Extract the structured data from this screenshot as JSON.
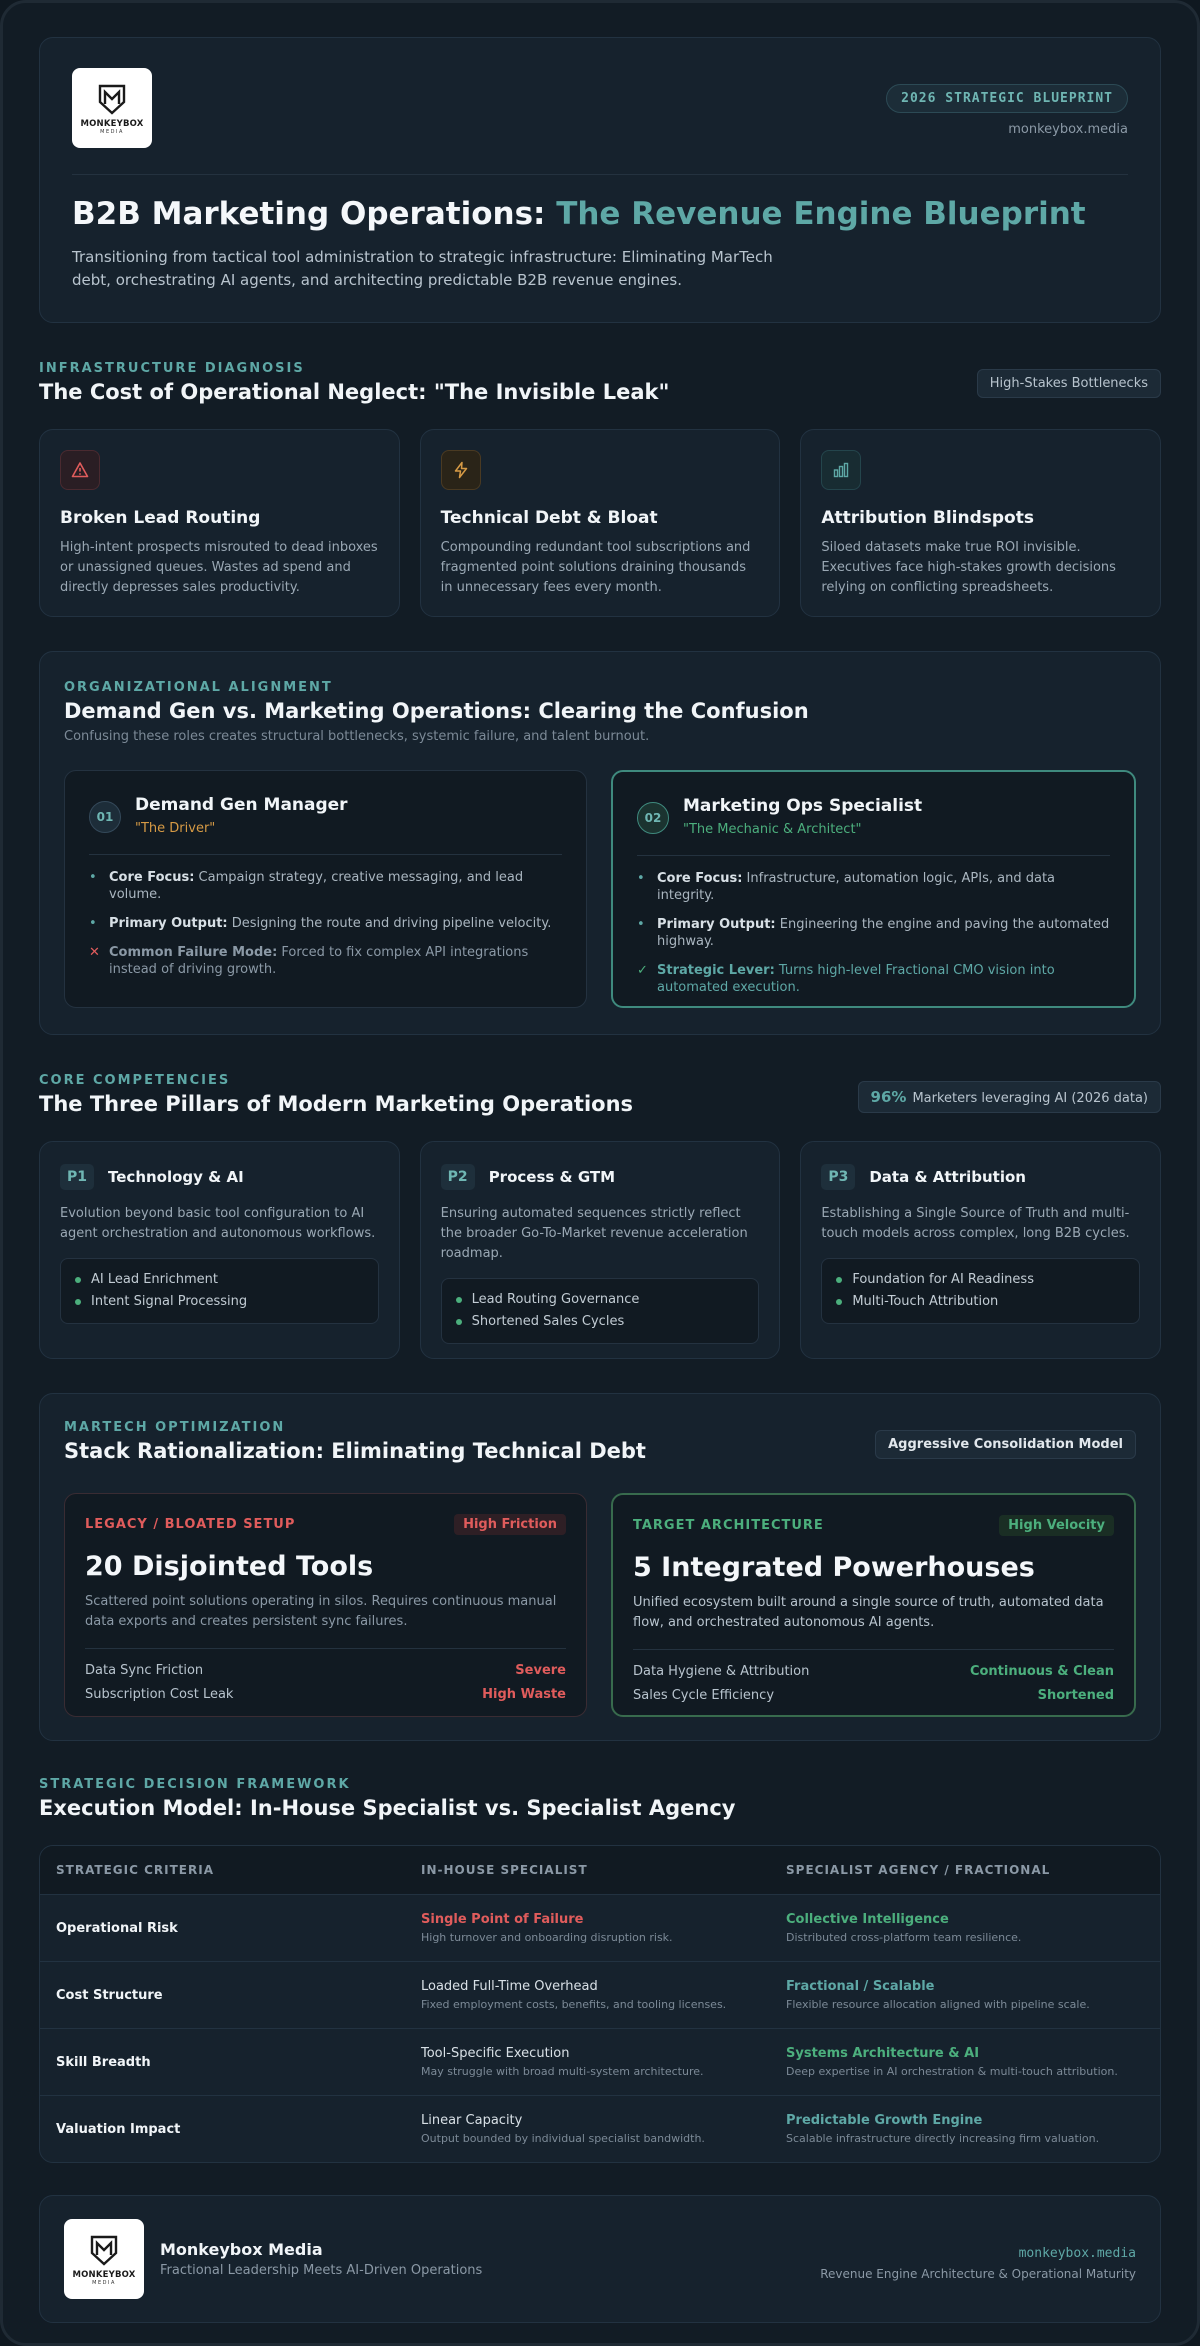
{
  "hero": {
    "logo": {
      "brand": "MONKEYBOX",
      "sub": "MEDIA"
    },
    "badge": "2026 STRATEGIC BLUEPRINT",
    "url": "monkeybox.media",
    "title_main": "B2B Marketing Operations: ",
    "title_accent": "The Revenue Engine Blueprint",
    "description": "Transitioning from tactical tool administration to strategic infrastructure: Eliminating MarTech debt, orchestrating AI agents, and architecting predictable B2B revenue engines."
  },
  "diagnosis": {
    "eyebrow": "INFRASTRUCTURE DIAGNOSIS",
    "title": "The Cost of Operational Neglect: \"The Invisible Leak\"",
    "tag": "High-Stakes Bottlenecks",
    "cards": [
      {
        "icon": "warning-icon",
        "color": "#e05c5c",
        "title": "Broken Lead Routing",
        "text": "High-intent prospects misrouted to dead inboxes or unassigned queues. Wastes ad spend and directly depresses sales productivity."
      },
      {
        "icon": "lightning-icon",
        "color": "#d69a45",
        "title": "Technical Debt & Bloat",
        "text": "Compounding redundant tool subscriptions and fragmented point solutions draining thousands in unnecessary fees every month."
      },
      {
        "icon": "bar-chart-icon",
        "color": "#5ea8a6",
        "title": "Attribution Blindspots",
        "text": "Siloed datasets make true ROI invisible. Executives face high-stakes growth decisions relying on conflicting spreadsheets."
      }
    ]
  },
  "alignment": {
    "eyebrow": "ORGANIZATIONAL ALIGNMENT",
    "title": "Demand Gen vs. Marketing Operations: Clearing the Confusion",
    "subtitle": "Confusing these roles creates structural bottlenecks, systemic failure, and talent burnout.",
    "roles": [
      {
        "num": "01",
        "title": "Demand Gen Manager",
        "nick": "\"The Driver\"",
        "nick_color": "#d69a45",
        "bullets": [
          {
            "mark": "•",
            "mark_color": "#5ea8a6",
            "label": "Core Focus:",
            "text": " Campaign strategy, creative messaging, and lead volume."
          },
          {
            "mark": "•",
            "mark_color": "#5ea8a6",
            "label": "Primary Output:",
            "text": " Designing the route and driving pipeline velocity."
          },
          {
            "mark": "✕",
            "mark_color": "#e05c5c",
            "label": "Common Failure Mode:",
            "text": " Forced to fix complex API integrations instead of driving growth."
          }
        ]
      },
      {
        "num": "02",
        "title": "Marketing Ops Specialist",
        "nick": "\"The Mechanic & Architect\"",
        "nick_color": "#4caf7d",
        "bullets": [
          {
            "mark": "•",
            "mark_color": "#5ea8a6",
            "label": "Core Focus:",
            "text": " Infrastructure, automation logic, APIs, and data integrity."
          },
          {
            "mark": "•",
            "mark_color": "#5ea8a6",
            "label": "Primary Output:",
            "text": " Engineering the engine and paving the automated highway."
          },
          {
            "mark": "✓",
            "mark_color": "#4caf7d",
            "label": "Strategic Lever:",
            "text": " Turns high-level Fractional CMO vision into automated execution."
          }
        ]
      }
    ]
  },
  "pillars": {
    "eyebrow": "CORE COMPETENCIES",
    "title": "The Three Pillars of Modern Marketing Operations",
    "stat_value": "96%",
    "stat_label": "Marketers leveraging AI (2026 data)",
    "items": [
      {
        "badge": "P1",
        "title": "Technology & AI",
        "text": "Evolution beyond basic tool configuration to AI agent orchestration and autonomous workflows.",
        "list": [
          "AI Lead Enrichment",
          "Intent Signal Processing"
        ]
      },
      {
        "badge": "P2",
        "title": "Process & GTM",
        "text": "Ensuring automated sequences strictly reflect the broader Go-To-Market revenue acceleration roadmap.",
        "list": [
          "Lead Routing Governance",
          "Shortened Sales Cycles"
        ]
      },
      {
        "badge": "P3",
        "title": "Data & Attribution",
        "text": "Establishing a Single Source of Truth and multi-touch models across complex, long B2B cycles.",
        "list": [
          "Foundation for AI Readiness",
          "Multi-Touch Attribution"
        ]
      }
    ]
  },
  "stack": {
    "eyebrow": "MARTECH OPTIMIZATION",
    "title": "Stack Rationalization: Eliminating Technical Debt",
    "tag": "Aggressive Consolidation Model",
    "legacy": {
      "label": "LEGACY / BLOATED SETUP",
      "chip": "High Friction",
      "headline": "20 Disjointed Tools",
      "text": "Scattered point solutions operating in silos. Requires continuous manual data exports and creates persistent sync failures.",
      "rows": [
        {
          "k": "Data Sync Friction",
          "v": "Severe"
        },
        {
          "k": "Subscription Cost Leak",
          "v": "High Waste"
        }
      ]
    },
    "target": {
      "label": "TARGET ARCHITECTURE",
      "chip": "High Velocity",
      "headline": "5 Integrated Powerhouses",
      "text": "Unified ecosystem built around a single source of truth, automated data flow, and orchestrated autonomous AI agents.",
      "rows": [
        {
          "k": "Data Hygiene & Attribution",
          "v": "Continuous & Clean"
        },
        {
          "k": "Sales Cycle Efficiency",
          "v": "Shortened"
        }
      ]
    },
    "colors": {
      "bad": "#e05c5c",
      "good": "#4caf7d"
    }
  },
  "execution": {
    "eyebrow": "STRATEGIC DECISION FRAMEWORK",
    "title": "Execution Model: In-House Specialist vs. Specialist Agency",
    "headers": [
      "STRATEGIC CRITERIA",
      "IN-HOUSE SPECIALIST",
      "SPECIALIST AGENCY / FRACTIONAL"
    ],
    "rows": [
      {
        "criteria": "Operational Risk",
        "inhouse_title": "Single Point of Failure",
        "inhouse_color": "#e05c5c",
        "inhouse_sub": "High turnover and onboarding disruption risk.",
        "agency_title": "Collective Intelligence",
        "agency_color": "#4caf7d",
        "agency_sub": "Distributed cross-platform team resilience."
      },
      {
        "criteria": "Cost Structure",
        "inhouse_title": "Loaded Full-Time Overhead",
        "inhouse_color": "#d8e0e6",
        "inhouse_sub": "Fixed employment costs, benefits, and tooling licenses.",
        "agency_title": "Fractional / Scalable",
        "agency_color": "#5ea8a6",
        "agency_sub": "Flexible resource allocation aligned with pipeline scale."
      },
      {
        "criteria": "Skill Breadth",
        "inhouse_title": "Tool-Specific Execution",
        "inhouse_color": "#d8e0e6",
        "inhouse_sub": "May struggle with broad multi-system architecture.",
        "agency_title": "Systems Architecture & AI",
        "agency_color": "#4caf7d",
        "agency_sub": "Deep expertise in AI orchestration & multi-touch attribution."
      },
      {
        "criteria": "Valuation Impact",
        "inhouse_title": "Linear Capacity",
        "inhouse_color": "#d8e0e6",
        "inhouse_sub": "Output bounded by individual specialist bandwidth.",
        "agency_title": "Predictable Growth Engine",
        "agency_color": "#5ea8a6",
        "agency_sub": "Scalable infrastructure directly increasing firm valuation."
      }
    ]
  },
  "footer": {
    "name": "Monkeybox Media",
    "tagline": "Fractional Leadership Meets AI-Driven Operations",
    "url": "monkeybox.media",
    "right_tag": "Revenue Engine Architecture & Operational Maturity"
  }
}
